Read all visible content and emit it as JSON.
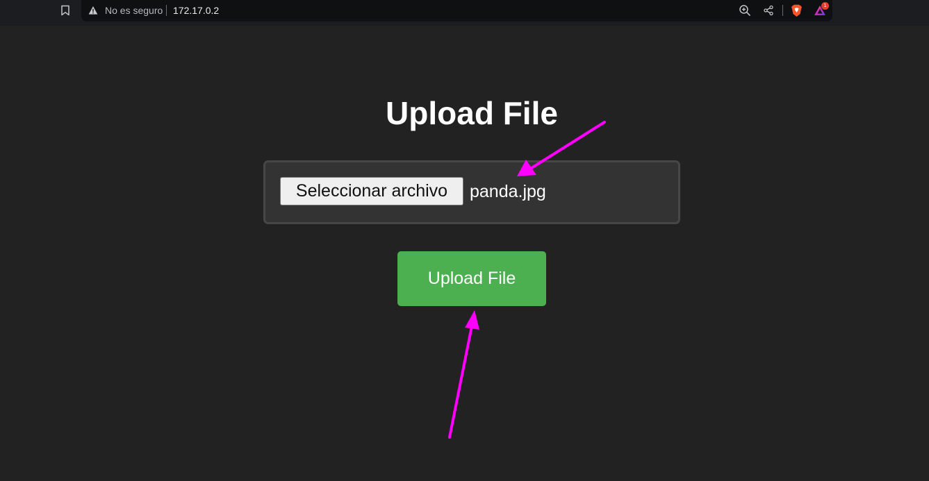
{
  "browser": {
    "security_label": "No es seguro",
    "url": "172.17.0.2",
    "notification_count": "1",
    "icons": [
      "bookmark-icon",
      "warning-icon",
      "zoom-icon",
      "share-icon",
      "brave-shields-icon",
      "brave-rewards-icon"
    ]
  },
  "page": {
    "title": "Upload File",
    "file_input": {
      "button_label": "Seleccionar archivo",
      "selected_file": "panda.jpg"
    },
    "submit_label": "Upload File"
  },
  "colors": {
    "background": "#222222",
    "panel": "#333333",
    "submit": "#4caf50",
    "annotation_arrow": "#ff00ff"
  }
}
